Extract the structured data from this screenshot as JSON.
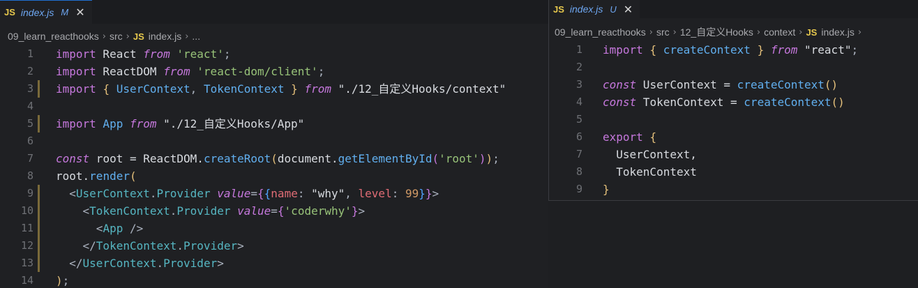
{
  "left": {
    "tab": {
      "badge": "JS",
      "name": "index.js",
      "status": "M",
      "close": "✕"
    },
    "breadcrumb": [
      "09_learn_reacthooks",
      "src",
      "index.js",
      "..."
    ],
    "lines": [
      {
        "n": "1",
        "code": [
          [
            "k",
            "import"
          ],
          [
            "id",
            " React "
          ],
          [
            "kc",
            "from"
          ],
          [
            "s",
            " 'react'"
          ],
          [
            "p",
            ";"
          ]
        ]
      },
      {
        "n": "2",
        "code": [
          [
            "k",
            "import"
          ],
          [
            "id",
            " ReactDOM "
          ],
          [
            "kc",
            "from"
          ],
          [
            "s",
            " 'react-dom/client'"
          ],
          [
            "p",
            ";"
          ]
        ]
      },
      {
        "n": "3",
        "code": [
          [
            "k",
            "import"
          ],
          [
            "p",
            " "
          ],
          [
            "b1",
            "{"
          ],
          [
            "v2",
            " UserContext"
          ],
          [
            "p",
            ","
          ],
          [
            "v2",
            " TokenContext "
          ],
          [
            "b1",
            "}"
          ],
          [
            "p",
            " "
          ],
          [
            "kc",
            "from"
          ],
          [
            "s2",
            " \"./12_自定义Hooks/context\""
          ]
        ],
        "mark": true
      },
      {
        "n": "4",
        "code": []
      },
      {
        "n": "5",
        "code": [
          [
            "k",
            "import"
          ],
          [
            "v2",
            " App "
          ],
          [
            "kc",
            "from"
          ],
          [
            "s2",
            " \"./12_自定义Hooks/App\""
          ]
        ],
        "mark": true
      },
      {
        "n": "6",
        "code": []
      },
      {
        "n": "7",
        "code": [
          [
            "kc",
            "const"
          ],
          [
            "id",
            " root = ReactDOM."
          ],
          [
            "fn",
            "createRoot"
          ],
          [
            "b1",
            "("
          ],
          [
            "id",
            "document."
          ],
          [
            "fn",
            "getElementById"
          ],
          [
            "b2",
            "("
          ],
          [
            "s",
            "'root'"
          ],
          [
            "b2",
            ")"
          ],
          [
            "b1",
            ")"
          ],
          [
            "p",
            ";"
          ]
        ]
      },
      {
        "n": "8",
        "code": [
          [
            "id",
            "root."
          ],
          [
            "fn",
            "render"
          ],
          [
            "b1",
            "("
          ]
        ]
      },
      {
        "n": "9",
        "code": [
          [
            "p",
            "  <"
          ],
          [
            "tag",
            "UserContext"
          ],
          [
            "p",
            "."
          ],
          [
            "tag",
            "Provider"
          ],
          [
            "attr",
            " value"
          ],
          [
            "p",
            "="
          ],
          [
            "b2",
            "{"
          ],
          [
            "b3",
            "{"
          ],
          [
            "prop",
            "name"
          ],
          [
            "p",
            ": "
          ],
          [
            "s2",
            "\"why\""
          ],
          [
            "p",
            ", "
          ],
          [
            "prop",
            "level"
          ],
          [
            "p",
            ": "
          ],
          [
            "num",
            "99"
          ],
          [
            "b3",
            "}"
          ],
          [
            "b2",
            "}"
          ],
          [
            "p",
            ">"
          ]
        ],
        "mark": true
      },
      {
        "n": "10",
        "code": [
          [
            "p",
            "    <"
          ],
          [
            "tag",
            "TokenContext"
          ],
          [
            "p",
            "."
          ],
          [
            "tag",
            "Provider"
          ],
          [
            "attr",
            " value"
          ],
          [
            "p",
            "="
          ],
          [
            "b2",
            "{"
          ],
          [
            "s",
            "'coderwhy'"
          ],
          [
            "b2",
            "}"
          ],
          [
            "p",
            ">"
          ]
        ],
        "mark": true
      },
      {
        "n": "11",
        "code": [
          [
            "p",
            "      <"
          ],
          [
            "tag",
            "App"
          ],
          [
            "p",
            " />"
          ]
        ],
        "mark": true
      },
      {
        "n": "12",
        "code": [
          [
            "p",
            "    </"
          ],
          [
            "tag",
            "TokenContext"
          ],
          [
            "p",
            "."
          ],
          [
            "tag",
            "Provider"
          ],
          [
            "p",
            ">"
          ]
        ],
        "mark": true
      },
      {
        "n": "13",
        "code": [
          [
            "p",
            "  </"
          ],
          [
            "tag",
            "UserContext"
          ],
          [
            "p",
            "."
          ],
          [
            "tag",
            "Provider"
          ],
          [
            "p",
            ">"
          ]
        ],
        "mark": true
      },
      {
        "n": "14",
        "code": [
          [
            "b1",
            ")"
          ],
          [
            "p",
            ";"
          ]
        ]
      }
    ]
  },
  "right": {
    "tab": {
      "badge": "JS",
      "name": "index.js",
      "status": "U",
      "close": "✕"
    },
    "breadcrumb": [
      "09_learn_reacthooks",
      "src",
      "12_自定义Hooks",
      "context",
      "index.js"
    ],
    "lines": [
      {
        "n": "1",
        "code": [
          [
            "k",
            "import"
          ],
          [
            "p",
            " "
          ],
          [
            "b1",
            "{"
          ],
          [
            "v2",
            " createContext "
          ],
          [
            "b1",
            "}"
          ],
          [
            "p",
            " "
          ],
          [
            "kc",
            "from"
          ],
          [
            "s2",
            " \"react\""
          ],
          [
            "p",
            ";"
          ]
        ]
      },
      {
        "n": "2",
        "code": []
      },
      {
        "n": "3",
        "code": [
          [
            "kc",
            "const"
          ],
          [
            "id",
            " UserContext = "
          ],
          [
            "fn",
            "createContext"
          ],
          [
            "b1",
            "()"
          ]
        ]
      },
      {
        "n": "4",
        "code": [
          [
            "kc",
            "const"
          ],
          [
            "id",
            " TokenContext = "
          ],
          [
            "fn",
            "createContext"
          ],
          [
            "b1",
            "()"
          ]
        ]
      },
      {
        "n": "5",
        "code": []
      },
      {
        "n": "6",
        "code": [
          [
            "k",
            "export"
          ],
          [
            "p",
            " "
          ],
          [
            "b1",
            "{"
          ]
        ]
      },
      {
        "n": "7",
        "code": [
          [
            "id",
            "  UserContext,"
          ]
        ]
      },
      {
        "n": "8",
        "code": [
          [
            "id",
            "  TokenContext"
          ]
        ]
      },
      {
        "n": "9",
        "code": [
          [
            "b1",
            "}"
          ]
        ]
      }
    ]
  }
}
